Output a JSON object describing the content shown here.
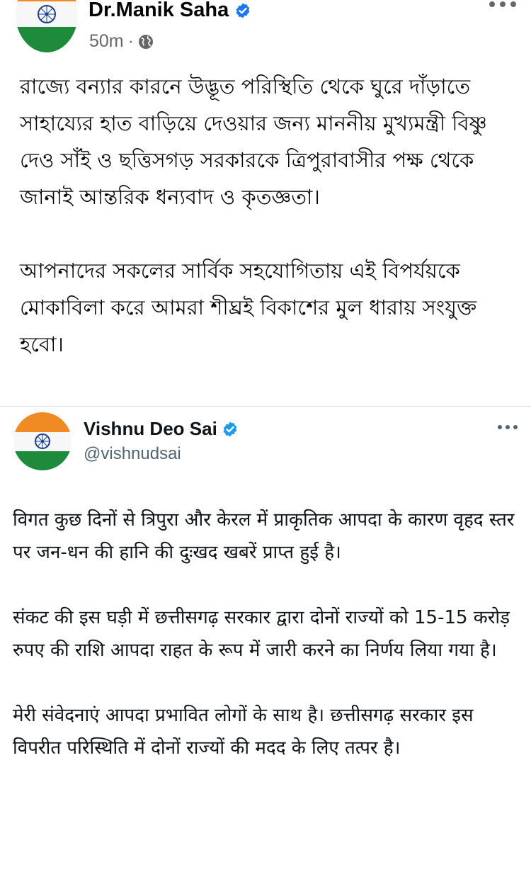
{
  "facebook_post": {
    "author_name": "Dr.Manik Saha",
    "timestamp": "50m",
    "separator": "·",
    "audience_icon": "globe-icon",
    "avatar": "india-flag-avatar",
    "paragraphs": [
      "রাজ্যে বন্যার কারনে উদ্ভূত পরিস্থিতি থেকে ঘুরে দাঁড়াতে সাহায্যের হাত বাড়িয়ে দেওয়ার জন্য মাননীয় মুখ্যমন্ত্রী বিষ্ণু দেও সাঁই ও ছত্তিসগড়  সরকারকে ত্রিপুরাবাসীর পক্ষ থেকে জানাই আন্তরিক ধন্যবাদ ও কৃতজ্ঞতা।",
      "আপনাদের সকলের সার্বিক সহযোগিতায় এই বিপর্যয়কে মোকাবিলা করে আমরা শীঘ্রই বিকাশের মুল ধারায় সংযুক্ত হবো।"
    ]
  },
  "x_post": {
    "display_name": "Vishnu Deo Sai",
    "handle": "@vishnudsai",
    "avatar": "india-flag-avatar",
    "paragraphs": [
      "विगत कुछ दिनों से त्रिपुरा और केरल में प्राकृतिक आपदा के कारण वृहद स्तर पर जन-धन की हानि की दुःखद खबरें प्राप्त हुई है।",
      "संकट की इस घड़ी में छत्तीसगढ़ सरकार द्वारा दोनों राज्यों को 15-15 करोड़ रुपए की राशि आपदा राहत के रूप में जारी करने का निर्णय लिया गया है।",
      "मेरी संवेदनाएं आपदा प्रभावित लोगों के साथ है। छत्तीसगढ़ सरकार इस विपरीत परिस्थिति में दोनों राज्यों की मदद के लिए तत्पर है।"
    ]
  },
  "colors": {
    "facebook_verified": "#1877f2",
    "x_verified": "#1d9bf0",
    "saffron": "#f08a24",
    "india_green": "#1e8a3c",
    "chakra_blue": "#1a3f8f",
    "meta_gray": "#65676b",
    "handle_gray": "#536471"
  }
}
